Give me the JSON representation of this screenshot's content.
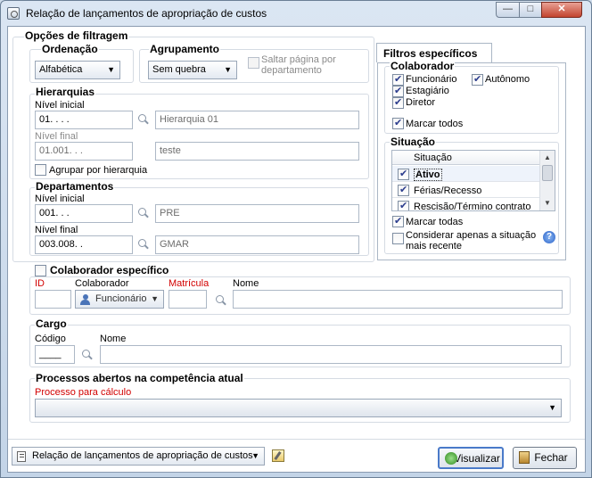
{
  "window": {
    "title": "Relação de lançamentos de apropriação de custos",
    "buttons": {
      "minimize": "—",
      "maximize": "□",
      "close": "✕"
    }
  },
  "filter_options": {
    "title": "Opções de filtragem",
    "ordenacao": {
      "title": "Ordenação",
      "value": "Alfabética"
    },
    "agrupamento": {
      "title": "Agrupamento",
      "value": "Sem quebra",
      "saltar_label": "Saltar página por departamento",
      "saltar_checked": false
    },
    "hierarquias": {
      "title": "Hierarquias",
      "nivel_inicial_label": "Nível inicial",
      "nivel_inicial_value": "01.  .  .  .",
      "nivel_inicial_desc": "Hierarquia 01",
      "nivel_final_label": "Nível final",
      "nivel_final_value": "01.001.  .  .",
      "nivel_final_desc": "teste",
      "agrupar_label": "Agrupar por hierarquia",
      "agrupar_checked": false
    },
    "departamentos": {
      "title": "Departamentos",
      "nivel_inicial_label": "Nível inicial",
      "nivel_inicial_value": "001.  .  .",
      "nivel_inicial_desc": "PRE",
      "nivel_final_label": "Nível final",
      "nivel_final_value": "003.008.  .",
      "nivel_final_desc": "GMAR"
    }
  },
  "filtros_especificos": {
    "tab_label": "Filtros específicos",
    "colaborador": {
      "title": "Colaborador",
      "items": [
        {
          "label": "Funcionário",
          "checked": true
        },
        {
          "label": "Autônomo",
          "checked": true
        },
        {
          "label": "Estagiário",
          "checked": true
        },
        {
          "label": "Diretor",
          "checked": true
        }
      ],
      "marcar_todos": "Marcar todos"
    },
    "situacao": {
      "title": "Situação",
      "column_header": "Situação",
      "items": [
        {
          "label": "Ativo",
          "checked": true
        },
        {
          "label": "Férias/Recesso",
          "checked": true
        },
        {
          "label": "Rescisão/Término contrato",
          "checked": true
        }
      ],
      "marcar_todas": "Marcar todas",
      "considerar_label": "Considerar apenas a situação mais recente",
      "considerar_checked": false
    }
  },
  "colaborador_especifico": {
    "title": "Colaborador específico",
    "checked": false,
    "id_label": "ID",
    "colaborador_label": "Colaborador",
    "colaborador_value": "Funcionário",
    "matricula_label": "Matrícula",
    "nome_label": "Nome"
  },
  "cargo": {
    "title": "Cargo",
    "codigo_label": "Código",
    "codigo_value": "____",
    "nome_label": "Nome"
  },
  "processos": {
    "title": "Processos abertos na competência atual",
    "processo_label": "Processo para cálculo"
  },
  "footer": {
    "report_value": "Relação de lançamentos de apropriação de custos",
    "visualizar": "Visualizar",
    "fechar": "Fechar"
  }
}
